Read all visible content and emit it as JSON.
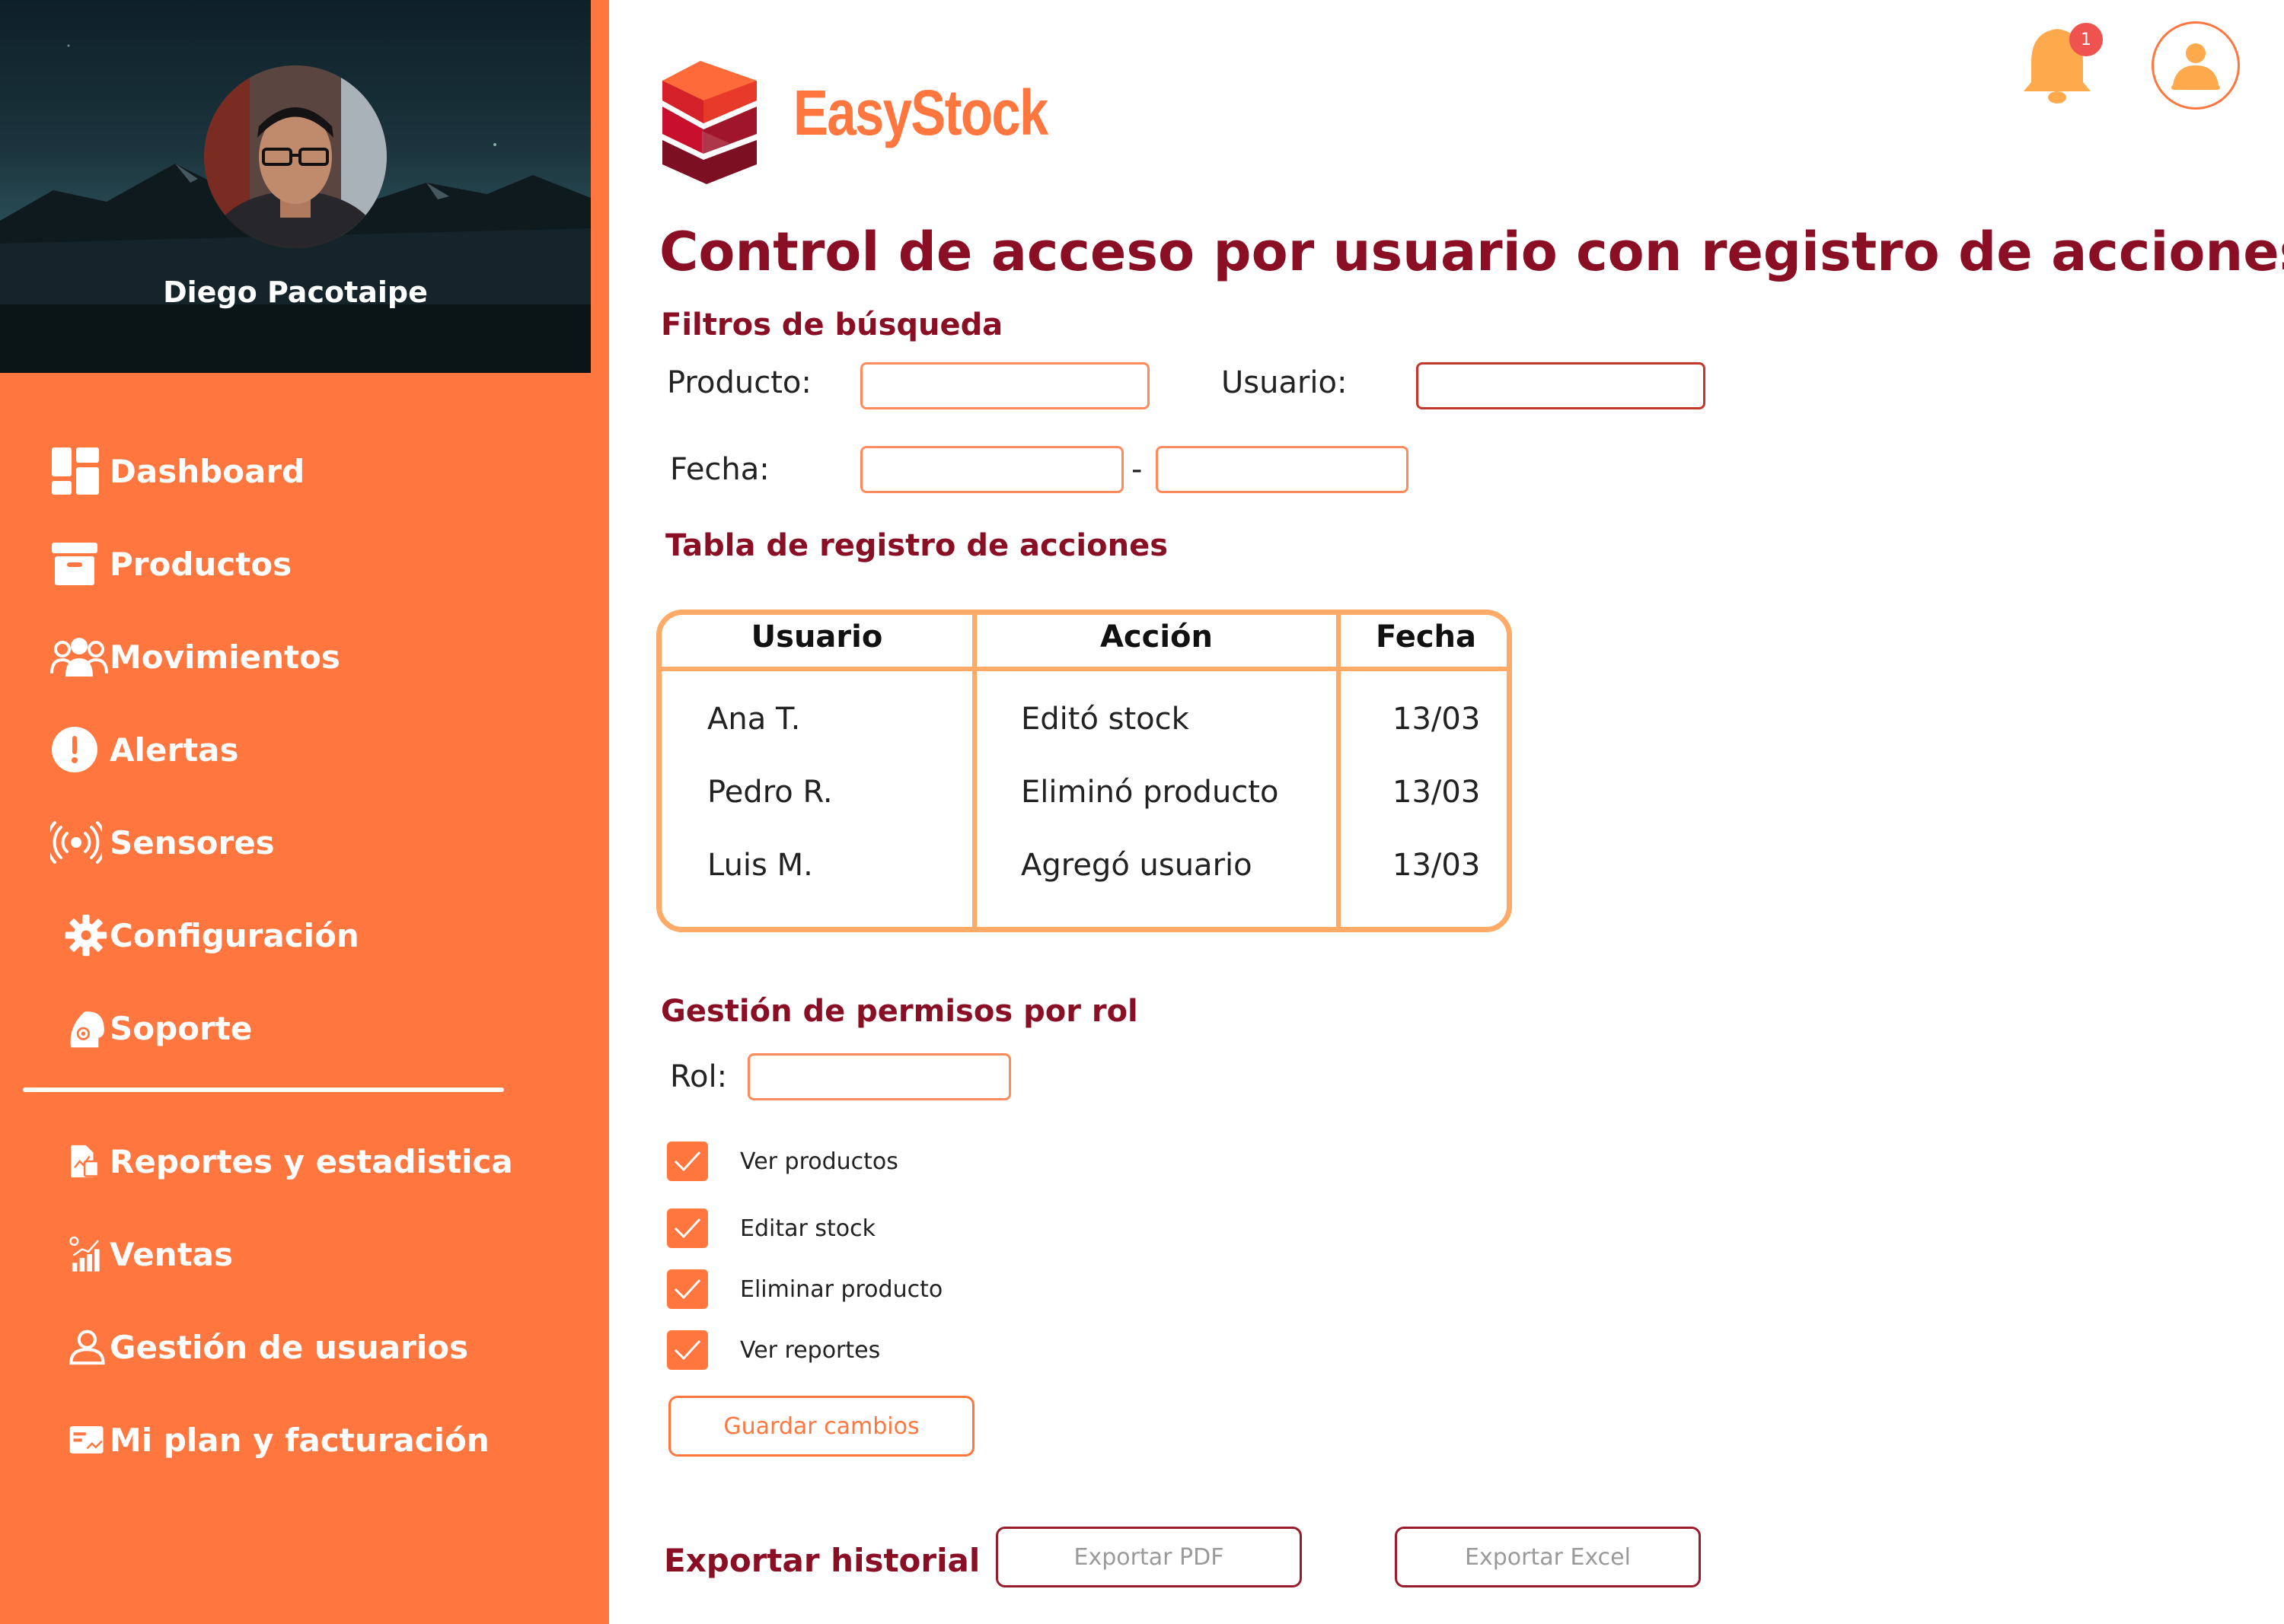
{
  "user": {
    "name": "Diego Pacotaipe"
  },
  "nav": {
    "primary": [
      {
        "label": "Dashboard",
        "icon": "dashboard-icon"
      },
      {
        "label": "Productos",
        "icon": "archive-box-icon"
      },
      {
        "label": "Movimientos",
        "icon": "users-group-icon"
      },
      {
        "label": "Alertas",
        "icon": "alert-icon"
      },
      {
        "label": "Sensores",
        "icon": "sensor-waves-icon"
      },
      {
        "label": "Configuración",
        "icon": "gear-icon"
      },
      {
        "label": "Soporte",
        "icon": "support-headset-icon"
      }
    ],
    "secondary": [
      {
        "label": "Reportes y estadistica",
        "icon": "report-file-icon"
      },
      {
        "label": "Ventas",
        "icon": "sales-chart-icon"
      },
      {
        "label": "Gestión de usuarios",
        "icon": "user-manage-icon"
      },
      {
        "label": "Mi plan y facturación",
        "icon": "billing-card-icon"
      }
    ]
  },
  "brand": {
    "name": "EasyStock",
    "color": "#ff773f",
    "logo_icon": "cube-logo-icon"
  },
  "header": {
    "notification_count": "1"
  },
  "page": {
    "title": "Control de acceso por usuario con registro de acciones"
  },
  "filters": {
    "title": "Filtros de búsqueda",
    "product_label": "Producto:",
    "product_value": "",
    "user_label": "Usuario:",
    "user_value": "",
    "date_label": "Fecha:",
    "date_from": "",
    "date_to": "",
    "date_separator": "-"
  },
  "log_table": {
    "title": "Tabla de registro de acciones",
    "columns": [
      "Usuario",
      "Acción",
      "Fecha"
    ],
    "rows": [
      [
        "Ana T.",
        "Editó stock",
        "13/03"
      ],
      [
        "Pedro R.",
        "Eliminó producto",
        "13/03"
      ],
      [
        "Luis M.",
        "Agregó usuario",
        "13/03"
      ]
    ]
  },
  "permissions": {
    "title": "Gestión de permisos por rol",
    "role_label": "Rol:",
    "role_value": "",
    "items": [
      {
        "label": "Ver productos",
        "checked": true
      },
      {
        "label": "Editar stock",
        "checked": true
      },
      {
        "label": "Eliminar producto",
        "checked": true
      },
      {
        "label": "Ver reportes",
        "checked": true
      }
    ],
    "save_label": "Guardar cambios"
  },
  "export": {
    "title": "Exportar historial",
    "pdf_label": "Exportar PDF",
    "excel_label": "Exportar Excel"
  },
  "colors": {
    "sidebar": "#ff773f",
    "title": "#8b0f24",
    "table_border": "#ffaa66",
    "badge": "#ef5350"
  }
}
